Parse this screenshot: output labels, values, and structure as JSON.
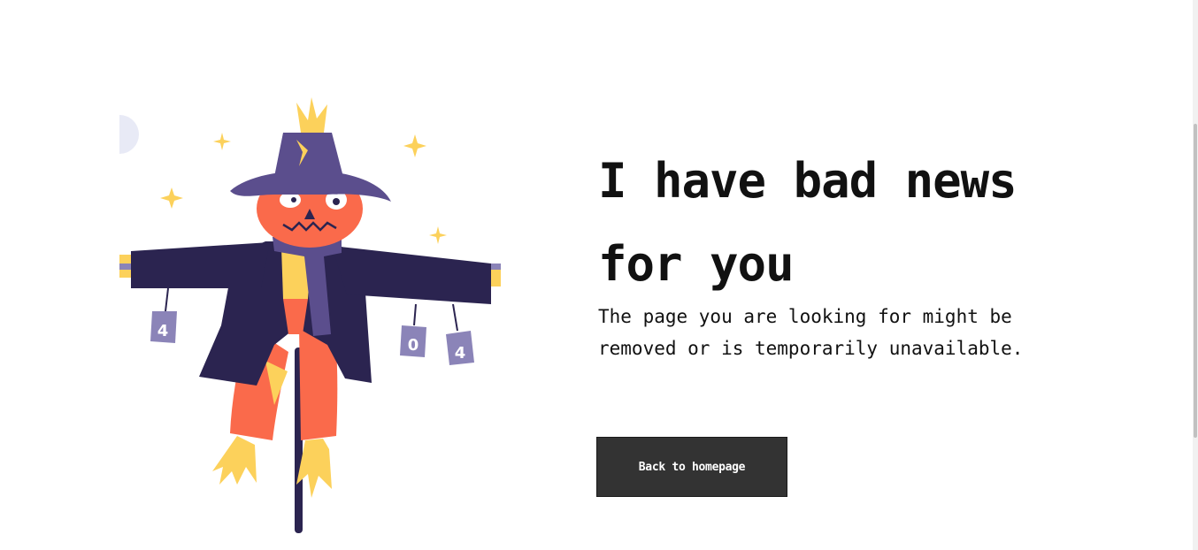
{
  "illustration": {
    "icon": "scarecrow-404-illustration",
    "can_labels": [
      "4",
      "0",
      "4"
    ]
  },
  "headline": "I have bad news for you",
  "message": "The page you are looking for might be removed or is temporarily unavailable.",
  "back_button": {
    "label": "Back to homepage"
  },
  "colors": {
    "background": "#ffffff",
    "text": "#111111",
    "button": "#333333",
    "hat": "#5b4e8d",
    "coat": "#2b2450",
    "pumpkin": "#fa6a4b",
    "straw": "#fcd15b"
  }
}
